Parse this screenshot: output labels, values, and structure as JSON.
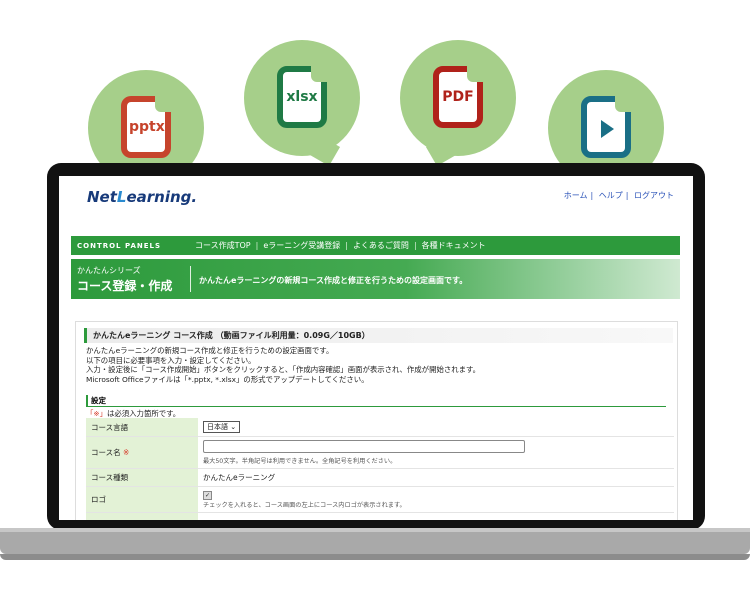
{
  "bubbles": [
    {
      "label": "pptx",
      "icon": "pptx-file-icon",
      "color": "#c6442c"
    },
    {
      "label": "xlsx",
      "icon": "xlsx-file-icon",
      "color": "#1f7a45"
    },
    {
      "label": "PDF",
      "icon": "pdf-file-icon",
      "color": "#b0221a"
    },
    {
      "label": "",
      "icon": "video-file-icon",
      "color": "#1a6f86"
    }
  ],
  "logo": {
    "prefix": "Net",
    "l": "L",
    "suffix": "earning."
  },
  "top_links": [
    "ホーム",
    "ヘルプ",
    "ログアウト"
  ],
  "nav": {
    "brand": "CONTROL PANELS",
    "items": [
      "コース作成TOP",
      "eラーニング受講登録",
      "よくあるご質問",
      "各種ドキュメント"
    ]
  },
  "banner": {
    "series": "かんたんシリーズ",
    "title": "コース登録・作成",
    "desc": "かんたんeラーニングの新規コース作成と修正を行うための設定画面です。"
  },
  "panel": {
    "title": "かんたんeラーニング コース作成 （動画ファイル利用量：0.09G／10GB）",
    "intro": [
      "かんたんeラーニングの新規コース作成と修正を行うための設定画面です。",
      "以下の項目に必要事項を入力・設定してください。",
      "入力・設定後に「コース作成開始」ボタンをクリックすると、「作成内容確認」画面が表示され、作成が開始されます。",
      "Microsoft Officeファイルは「*.pptx, *.xlsx」の形式でアップデートしてください。"
    ],
    "section": "設定",
    "required_note_mark": "「※」",
    "required_note_text": "は必須入力箇所です。",
    "rows": {
      "language_label": "コース言語",
      "language_value": "日本語",
      "name_label": "コース名",
      "name_required": "※",
      "name_note": "最大50文字。半角記号は利用できません。全角記号を利用ください。",
      "type_label": "コース種類",
      "type_value": "かんたんeラーニング",
      "logo_label": "ロゴ",
      "logo_note": "チェックを入れると、コース画面の左上にコース内ロゴが表示されます。"
    }
  }
}
